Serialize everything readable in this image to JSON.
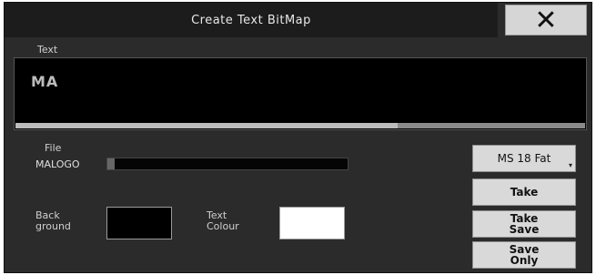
{
  "dialog": {
    "title": "Create Text BitMap",
    "close_label": "✕"
  },
  "text_section": {
    "label": "Text",
    "value": "MA"
  },
  "file_section": {
    "label": "File",
    "value": "MALOGO"
  },
  "background": {
    "label": "Back\nground",
    "color": "#000000"
  },
  "text_colour": {
    "label": "Text\nColour",
    "color": "#ffffff"
  },
  "buttons": {
    "font": "MS 18 Fat",
    "take": "Take",
    "take_save": "Take\nSave",
    "save_only": "Save\nOnly"
  }
}
